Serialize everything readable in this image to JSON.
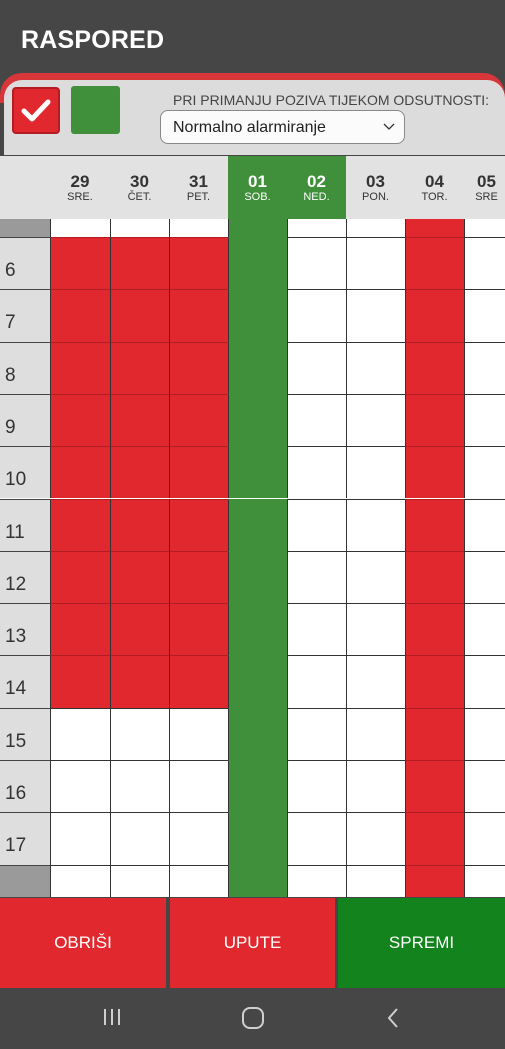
{
  "app": {
    "title": "RASPORED"
  },
  "controls": {
    "mode_label": "PRI PRIMANJU POZIVA TIJEKOM ODSUTNOSTI:",
    "mode_value": "Normalno alarmiranje",
    "colors": {
      "red": "#e0282e",
      "green": "#3f8f3b"
    }
  },
  "days": [
    {
      "num": "29",
      "name": "SRE.",
      "weekend": false
    },
    {
      "num": "30",
      "name": "ČET.",
      "weekend": false
    },
    {
      "num": "31",
      "name": "PET.",
      "weekend": false
    },
    {
      "num": "01",
      "name": "SOB.",
      "weekend": true
    },
    {
      "num": "02",
      "name": "NED.",
      "weekend": true
    },
    {
      "num": "03",
      "name": "PON.",
      "weekend": false
    },
    {
      "num": "04",
      "name": "TOR.",
      "weekend": false
    },
    {
      "num": "05",
      "name": "SRE",
      "weekend": false
    }
  ],
  "hours": [
    {
      "label": "6",
      "cells": [
        "red",
        "red",
        "red",
        "green",
        "white",
        "white",
        "red",
        "white"
      ]
    },
    {
      "label": "7",
      "cells": [
        "red",
        "red",
        "red",
        "green",
        "white",
        "white",
        "red",
        "white"
      ]
    },
    {
      "label": "8",
      "cells": [
        "red",
        "red",
        "red",
        "green",
        "white",
        "white",
        "red",
        "white"
      ]
    },
    {
      "label": "9",
      "cells": [
        "red",
        "red",
        "red",
        "green",
        "white",
        "white",
        "red",
        "white"
      ]
    },
    {
      "label": "10",
      "cells": [
        "red",
        "red",
        "red",
        "green",
        "white",
        "white",
        "red",
        "white"
      ]
    },
    {
      "label": "11",
      "cells": [
        "red",
        "red",
        "red",
        "green",
        "white",
        "white",
        "red",
        "white"
      ]
    },
    {
      "label": "12",
      "cells": [
        "red",
        "red",
        "red",
        "green",
        "white",
        "white",
        "red",
        "white"
      ]
    },
    {
      "label": "13",
      "cells": [
        "red",
        "red",
        "red",
        "green",
        "white",
        "white",
        "red",
        "white"
      ]
    },
    {
      "label": "14",
      "cells": [
        "red",
        "red",
        "red",
        "green",
        "white",
        "white",
        "red",
        "white"
      ]
    },
    {
      "label": "15",
      "cells": [
        "white",
        "white",
        "white",
        "green",
        "white",
        "white",
        "red",
        "white"
      ]
    },
    {
      "label": "16",
      "cells": [
        "white",
        "white",
        "white",
        "green",
        "white",
        "white",
        "red",
        "white"
      ]
    },
    {
      "label": "17",
      "cells": [
        "white",
        "white",
        "white",
        "green",
        "white",
        "white",
        "red",
        "white"
      ]
    }
  ],
  "partial_rows": {
    "top_cells": [
      "white",
      "white",
      "white",
      "green",
      "white",
      "white",
      "red",
      "white"
    ],
    "bottom_cells": [
      "white",
      "white",
      "white",
      "green",
      "white",
      "white",
      "red",
      "white"
    ]
  },
  "buttons": {
    "delete": "OBRIŠI",
    "help": "UPUTE",
    "save": "SPREMI"
  },
  "system_nav": {
    "recent": "recent-apps-icon",
    "home": "home-icon",
    "back": "back-icon"
  }
}
